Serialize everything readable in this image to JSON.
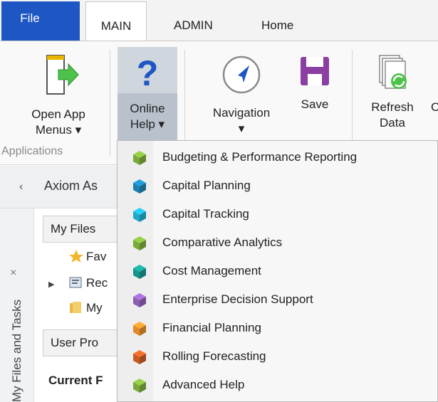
{
  "tabs": {
    "file": "File",
    "main": "MAIN",
    "admin": "ADMIN",
    "home": "Home"
  },
  "ribbon": {
    "open_app_menus": [
      "Open App",
      "Menus ▾"
    ],
    "online_help": [
      "Online",
      "Help ▾"
    ],
    "navigation": "Navigation",
    "navigation_arrow": "▾",
    "save": "Save",
    "refresh_data": [
      "Refresh",
      "Data"
    ],
    "group_label": "Applications"
  },
  "panel": {
    "back_chevron": "‹",
    "title": "Axiom As",
    "vertical_tab": "My Files and Tasks",
    "close_glyph": "×",
    "my_files": "My Files",
    "tree": [
      "Fav",
      "Rec",
      "My"
    ],
    "user_profile": "User Pro",
    "current": "Current F"
  },
  "menu": {
    "items": [
      {
        "label": "Budgeting & Performance Reporting",
        "color": "#7aa83a"
      },
      {
        "label": "Capital Planning",
        "color": "#1b7fb0"
      },
      {
        "label": "Capital Tracking",
        "color": "#1ea8c9"
      },
      {
        "label": "Comparative Analytics",
        "color": "#7aa83a"
      },
      {
        "label": "Cost Management",
        "color": "#17948a"
      },
      {
        "label": "Enterprise Decision Support",
        "color": "#8d5db3"
      },
      {
        "label": "Financial Planning",
        "color": "#e08a2a"
      },
      {
        "label": "Rolling Forecasting",
        "color": "#c65a24"
      },
      {
        "label": "Advanced Help",
        "color": "#7aa83a"
      }
    ]
  },
  "colors": {
    "file_tab": "#1e56c4",
    "help_icon": "#1e56c4",
    "save_icon": "#8b3fa3",
    "arrow_green": "#4cc24a"
  }
}
